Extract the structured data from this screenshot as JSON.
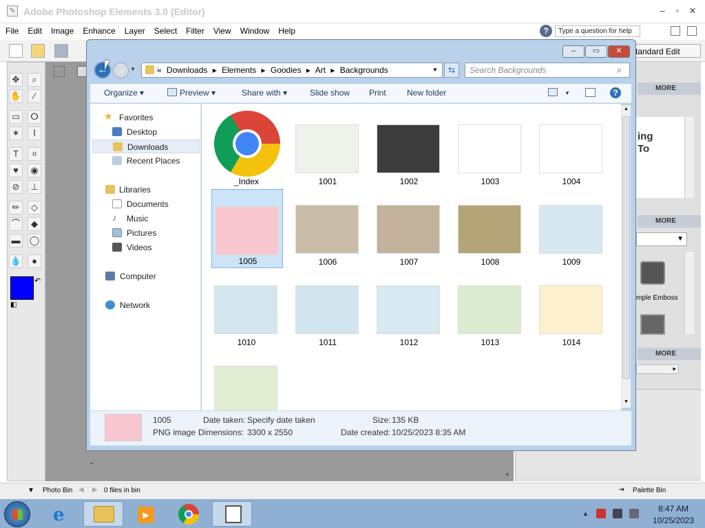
{
  "ps": {
    "title": "Adobe Photoshop Elements 3.0 (Editor)",
    "menu": [
      "File",
      "Edit",
      "Image",
      "Enhance",
      "Layer",
      "Select",
      "Filter",
      "View",
      "Window",
      "Help"
    ],
    "help_placeholder": "Type a question for help",
    "standard_edit": "tandard Edit",
    "more": "MORE",
    "panel_texts": [
      "ing",
      "To",
      "mple Emboss"
    ],
    "photo_bin": "Photo Bin",
    "files_in_bin": "0 files in bin",
    "palette_bin": "Palette Bin",
    "fg_color": "#0000ff"
  },
  "explorer": {
    "breadcrumb": [
      "«",
      "Downloads",
      "▸",
      "Elements",
      "▸",
      "Goodies",
      "▸",
      "Art",
      "▸",
      "Backgrounds"
    ],
    "search_placeholder": "Search Backgrounds",
    "commands": {
      "organize": "Organize ▾",
      "preview": "Preview ▾",
      "share": "Share with ▾",
      "slideshow": "Slide show",
      "print": "Print",
      "newfolder": "New folder"
    },
    "nav": {
      "favorites": "Favorites",
      "desktop": "Desktop",
      "downloads": "Downloads",
      "recent": "Recent Places",
      "libraries": "Libraries",
      "documents": "Documents",
      "music": "Music",
      "pictures": "Pictures",
      "videos": "Videos",
      "computer": "Computer",
      "network": "Network"
    },
    "files": [
      {
        "name": "_Index",
        "color": "chrome"
      },
      {
        "name": "1001",
        "color": "#eef2ea"
      },
      {
        "name": "1002",
        "color": "#3c3c3c"
      },
      {
        "name": "1003",
        "color": "#ffffff"
      },
      {
        "name": "1004",
        "color": "#ffffff"
      },
      {
        "name": "1005",
        "color": "#f8c6cf"
      },
      {
        "name": "1006",
        "color": "#c9bda9"
      },
      {
        "name": "1007",
        "color": "#c2b29b"
      },
      {
        "name": "1008",
        "color": "#b3a578"
      },
      {
        "name": "1009",
        "color": "#d7e8f1"
      },
      {
        "name": "1010",
        "color": "#d4e6ee"
      },
      {
        "name": "1011",
        "color": "#d2e5ef"
      },
      {
        "name": "1012",
        "color": "#d7e9f1"
      },
      {
        "name": "1013",
        "color": "#dcecd2"
      },
      {
        "name": "1014",
        "color": "#fdf0cf"
      },
      {
        "name": "",
        "color": "#e2edd4"
      }
    ],
    "details": {
      "name": "1005",
      "type": "PNG image",
      "date_taken_label": "Date taken:",
      "date_taken": "Specify date taken",
      "dimensions_label": "Dimensions:",
      "dimensions": "3300 x 2550",
      "size_label": "Size:",
      "size": "135 KB",
      "created_label": "Date created:",
      "created": "10/25/2023 8:35 AM",
      "thumb_color": "#f8c6cf"
    }
  },
  "taskbar": {
    "time": "8:47 AM",
    "date": "10/25/2023"
  }
}
